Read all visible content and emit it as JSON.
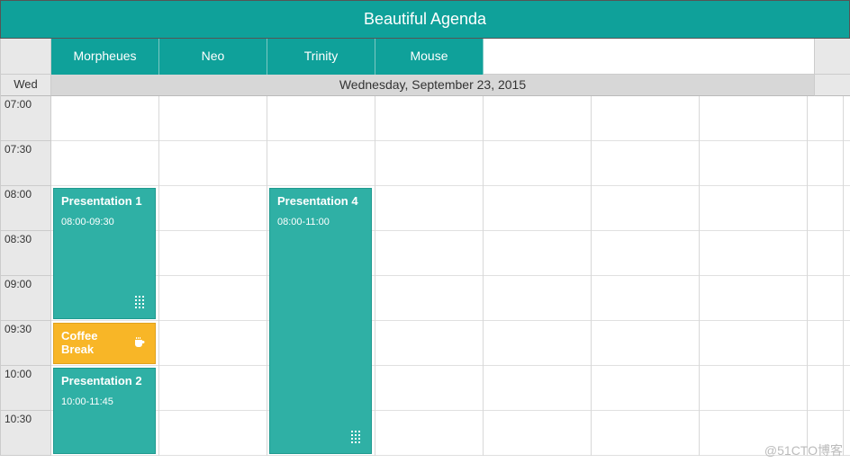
{
  "app": {
    "title": "Beautiful Agenda"
  },
  "resources": [
    "Morpheues",
    "Neo",
    "Trinity",
    "Mouse"
  ],
  "day": {
    "short": "Wed",
    "full": "Wednesday, September 23, 2015"
  },
  "timeSlots": [
    "07:00",
    "07:30",
    "08:00",
    "08:30",
    "09:00",
    "09:30",
    "10:00",
    "10:30"
  ],
  "slotHeight": 50,
  "appointments": [
    {
      "col": 0,
      "startIdx": 2,
      "span": 3,
      "title": "Presentation 1",
      "time": "08:00-09:30",
      "type": "normal",
      "grip": true
    },
    {
      "col": 0,
      "startIdx": 5,
      "span": 1,
      "title": "Coffee Break",
      "time": "",
      "type": "break",
      "grip": false
    },
    {
      "col": 0,
      "startIdx": 6,
      "span": 2,
      "title": "Presentation 2",
      "time": "10:00-11:45",
      "type": "normal",
      "grip": false
    },
    {
      "col": 2,
      "startIdx": 2,
      "span": 6,
      "title": "Presentation 4",
      "time": "08:00-11:00",
      "type": "normal",
      "grip": true
    }
  ],
  "watermark": "@51CTO博客",
  "colors": {
    "primary": "#0fa19a",
    "appointment": "#2fb0a5",
    "break": "#f8b627"
  }
}
